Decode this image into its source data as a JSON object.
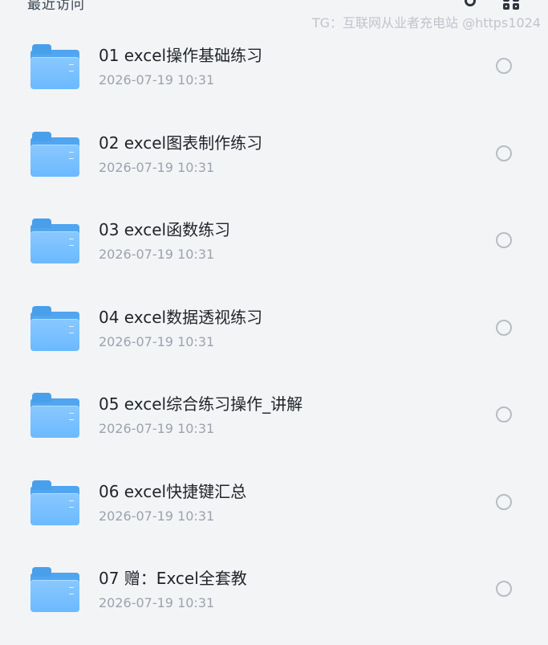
{
  "header": {
    "left_partial_text": "最近访问",
    "watermark": "TG：互联网从业者充电站 @https1024"
  },
  "folders": [
    {
      "name": "01 excel操作基础练习",
      "date": "2026-07-19 10:31"
    },
    {
      "name": "02 excel图表制作练习",
      "date": "2026-07-19 10:31"
    },
    {
      "name": "03 excel函数练习",
      "date": "2026-07-19 10:31"
    },
    {
      "name": "04 excel数据透视练习",
      "date": "2026-07-19 10:31"
    },
    {
      "name": "05 excel综合练习操作_讲解",
      "date": "2026-07-19 10:31"
    },
    {
      "name": "06 excel快捷键汇总",
      "date": "2026-07-19 10:31"
    },
    {
      "name": "07 赠：Excel全套教",
      "date": "2026-07-19 10:31"
    }
  ],
  "icons": {
    "folder": "folder-icon",
    "select": "unchecked-circle-icon",
    "search": "search-icon",
    "grid": "grid-view-icon"
  },
  "colors": {
    "background": "#f3f4f6",
    "folder_blue": "#6bb9ff",
    "title_text": "#1f2329",
    "date_text": "#9ca3af",
    "watermark_text": "#c0c4cb",
    "circle_border": "#b8bcc4"
  }
}
